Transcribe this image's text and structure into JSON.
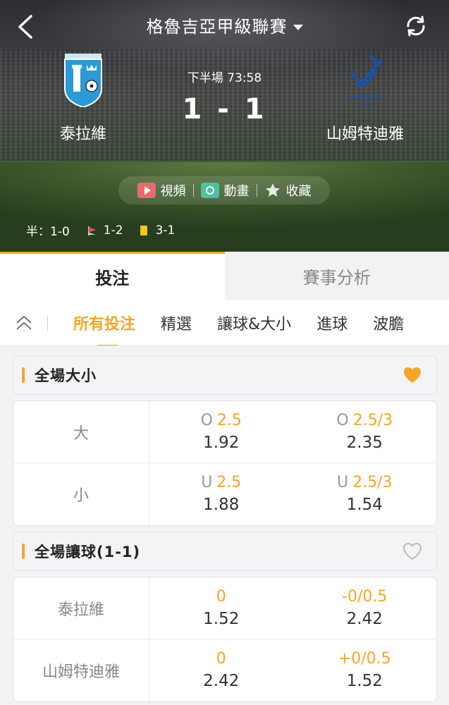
{
  "header": {
    "league_title": "格魯吉亞甲級聯賽",
    "back_icon": "chevron-left-icon",
    "refresh_icon": "refresh-icon",
    "home_team": "泰拉維",
    "away_team": "山姆特迪雅",
    "match_status": "下半場  73:58",
    "score": "1 - 1",
    "media": [
      {
        "label": "視頻",
        "icon": "video-icon"
      },
      {
        "label": "動畫",
        "icon": "animation-icon"
      },
      {
        "label": "收藏",
        "icon": "star-icon"
      }
    ],
    "stats": {
      "half_time": "半：1-0",
      "corners": "1-2",
      "yellow_cards": "3-1"
    }
  },
  "main_tabs": [
    {
      "label": "投注",
      "active": true
    },
    {
      "label": "賽事分析",
      "active": false
    }
  ],
  "sub_tabs": [
    {
      "label": "所有投注",
      "active": true
    },
    {
      "label": "精選",
      "active": false
    },
    {
      "label": "讓球&大小",
      "active": false
    },
    {
      "label": "進球",
      "active": false
    },
    {
      "label": "波膽",
      "active": false
    }
  ],
  "sections": [
    {
      "title": "全場大小",
      "favorited": true,
      "rows": [
        {
          "label": "大",
          "cells": [
            {
              "prefix": "O",
              "line": "2.5",
              "price": "1.92"
            },
            {
              "prefix": "O",
              "line": "2.5/3",
              "price": "2.35"
            }
          ]
        },
        {
          "label": "小",
          "cells": [
            {
              "prefix": "U",
              "line": "2.5",
              "price": "1.88"
            },
            {
              "prefix": "U",
              "line": "2.5/3",
              "price": "1.54"
            }
          ]
        }
      ]
    },
    {
      "title": "全場讓球(1-1)",
      "favorited": false,
      "rows": [
        {
          "label": "泰拉維",
          "cells": [
            {
              "prefix": "",
              "line": "0",
              "price": "1.52"
            },
            {
              "prefix": "",
              "line": "-0/0.5",
              "price": "2.42"
            }
          ]
        },
        {
          "label": "山姆特迪雅",
          "cells": [
            {
              "prefix": "",
              "line": "0",
              "price": "2.42"
            },
            {
              "prefix": "",
              "line": "+0/0.5",
              "price": "1.52"
            }
          ]
        }
      ]
    }
  ],
  "colors": {
    "accent": "#f5a623",
    "heart_active": "#f5a623",
    "heart_inactive": "#bbbbbb"
  }
}
